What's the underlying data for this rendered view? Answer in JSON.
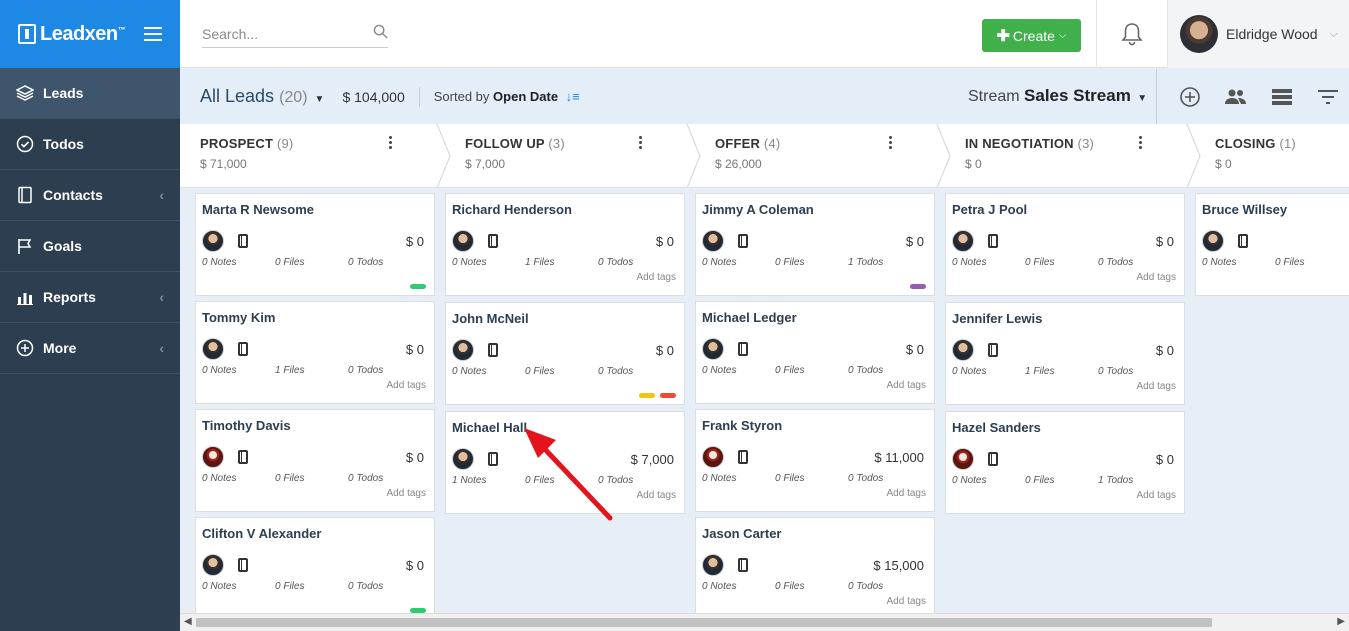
{
  "brand": {
    "name": "Leadxen",
    "tm": "™"
  },
  "nav": [
    {
      "label": "Leads",
      "icon": "layers-icon",
      "active": true,
      "chevron": false
    },
    {
      "label": "Todos",
      "icon": "check-circle-icon",
      "active": false,
      "chevron": false
    },
    {
      "label": "Contacts",
      "icon": "address-book-icon",
      "active": false,
      "chevron": true
    },
    {
      "label": "Goals",
      "icon": "flag-icon",
      "active": false,
      "chevron": false
    },
    {
      "label": "Reports",
      "icon": "bar-chart-icon",
      "active": false,
      "chevron": true
    },
    {
      "label": "More",
      "icon": "plus-circle-icon",
      "active": false,
      "chevron": true
    }
  ],
  "topbar": {
    "search_placeholder": "Search...",
    "create_label": "Create",
    "user_name": "Eldridge Wood"
  },
  "subhead": {
    "title": "All Leads",
    "count": "(20)",
    "total": "$ 104,000",
    "sorted_prefix": "Sorted by",
    "sorted_field": "Open Date",
    "stream_prefix": "Stream",
    "stream_name": "Sales Stream"
  },
  "stages": [
    {
      "name": "PROSPECT",
      "count": "(9)",
      "amount": "$ 71,000"
    },
    {
      "name": "FOLLOW UP",
      "count": "(3)",
      "amount": "$ 7,000"
    },
    {
      "name": "OFFER",
      "count": "(4)",
      "amount": "$ 26,000"
    },
    {
      "name": "IN NEGOTIATION",
      "count": "(3)",
      "amount": "$ 0"
    },
    {
      "name": "CLOSING",
      "count": "(1)",
      "amount": "$ 0"
    }
  ],
  "columns": [
    [
      {
        "name": "Marta R Newsome",
        "amount": "$ 0",
        "notes": "0 Notes",
        "files": "0 Files",
        "todos": "0 Todos",
        "add_tags": "",
        "tags": [
          "#2ecc71"
        ],
        "avatar": "a"
      },
      {
        "name": "Tommy Kim",
        "amount": "$ 0",
        "notes": "0 Notes",
        "files": "1 Files",
        "todos": "0 Todos",
        "add_tags": "Add tags",
        "tags": [],
        "avatar": "a"
      },
      {
        "name": "Timothy Davis",
        "amount": "$ 0",
        "notes": "0 Notes",
        "files": "0 Files",
        "todos": "0 Todos",
        "add_tags": "Add tags",
        "tags": [],
        "avatar": "b"
      },
      {
        "name": "Clifton V Alexander",
        "amount": "$ 0",
        "notes": "0 Notes",
        "files": "0 Files",
        "todos": "0 Todos",
        "add_tags": "",
        "tags": [
          "#2ecc71"
        ],
        "avatar": "a"
      }
    ],
    [
      {
        "name": "Richard Henderson",
        "amount": "$ 0",
        "notes": "0 Notes",
        "files": "1 Files",
        "todos": "0 Todos",
        "add_tags": "Add tags",
        "tags": [],
        "avatar": "a"
      },
      {
        "name": "John McNeil",
        "amount": "$ 0",
        "notes": "0 Notes",
        "files": "0 Files",
        "todos": "0 Todos",
        "add_tags": "",
        "tags": [
          "#f1c40f",
          "#e74c3c"
        ],
        "avatar": "a"
      },
      {
        "name": "Michael Hall",
        "amount": "$ 7,000",
        "notes": "1 Notes",
        "files": "0 Files",
        "todos": "0 Todos",
        "add_tags": "Add tags",
        "tags": [],
        "avatar": "a"
      }
    ],
    [
      {
        "name": "Jimmy A Coleman",
        "amount": "$ 0",
        "notes": "0 Notes",
        "files": "0 Files",
        "todos": "1 Todos",
        "add_tags": "",
        "tags": [
          "#9b59b6"
        ],
        "avatar": "a"
      },
      {
        "name": "Michael Ledger",
        "amount": "$ 0",
        "notes": "0 Notes",
        "files": "0 Files",
        "todos": "0 Todos",
        "add_tags": "Add tags",
        "tags": [],
        "avatar": "a"
      },
      {
        "name": "Frank Styron",
        "amount": "$ 11,000",
        "notes": "0 Notes",
        "files": "0 Files",
        "todos": "0 Todos",
        "add_tags": "Add tags",
        "tags": [],
        "avatar": "b"
      },
      {
        "name": "Jason Carter",
        "amount": "$ 15,000",
        "notes": "0 Notes",
        "files": "0 Files",
        "todos": "0 Todos",
        "add_tags": "Add tags",
        "tags": [],
        "avatar": "a"
      }
    ],
    [
      {
        "name": "Petra J Pool",
        "amount": "$ 0",
        "notes": "0 Notes",
        "files": "0 Files",
        "todos": "0 Todos",
        "add_tags": "Add tags",
        "tags": [],
        "avatar": "a"
      },
      {
        "name": "Jennifer Lewis",
        "amount": "$ 0",
        "notes": "0 Notes",
        "files": "1 Files",
        "todos": "0 Todos",
        "add_tags": "Add tags",
        "tags": [],
        "avatar": "a"
      },
      {
        "name": "Hazel Sanders",
        "amount": "$ 0",
        "notes": "0 Notes",
        "files": "0 Files",
        "todos": "1 Todos",
        "add_tags": "Add tags",
        "tags": [],
        "avatar": "b"
      }
    ],
    [
      {
        "name": "Bruce Willsey",
        "amount": "",
        "notes": "0 Notes",
        "files": "0 Files",
        "todos": "",
        "add_tags": "",
        "tags": [],
        "avatar": "a"
      }
    ]
  ],
  "colors": {
    "brand": "#1e88e5",
    "sidebar": "#2c3e50",
    "create": "#3fb04a",
    "arrow": "#e3141c"
  }
}
